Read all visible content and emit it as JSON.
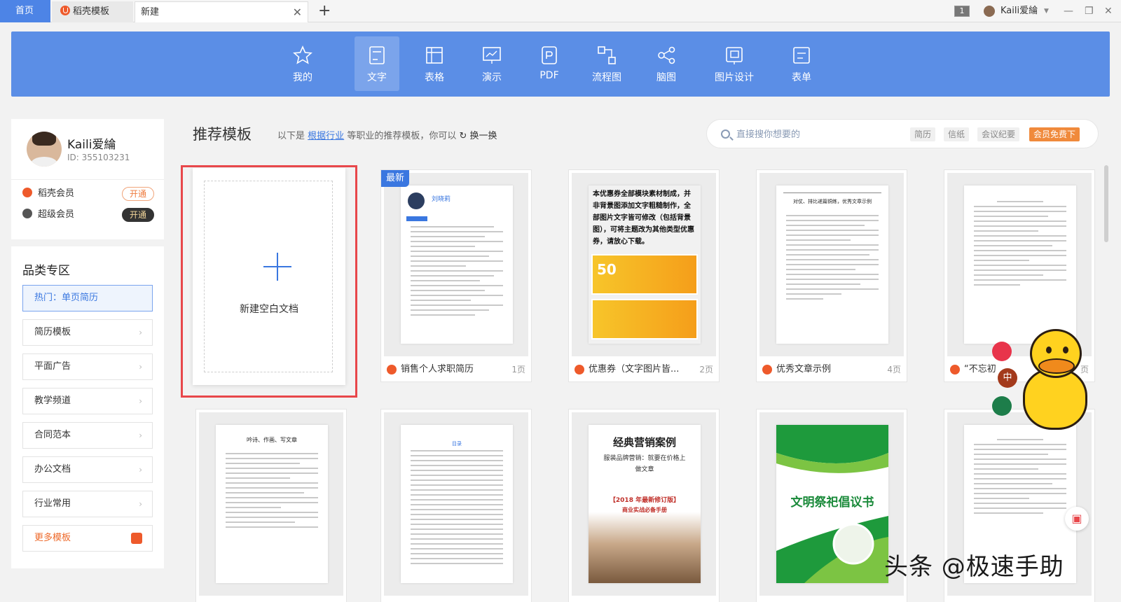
{
  "tabs": {
    "home": "首页",
    "templates": "稻壳模板",
    "current": "新建",
    "close": "✕",
    "add": "+"
  },
  "window": {
    "count": "1",
    "user": "Kaili爱綸",
    "minimize": "—",
    "restore": "❐",
    "close": "✕"
  },
  "nav": [
    {
      "label": "我的",
      "icon": "star-icon"
    },
    {
      "label": "文字",
      "icon": "document-icon"
    },
    {
      "label": "表格",
      "icon": "table-icon"
    },
    {
      "label": "演示",
      "icon": "presentation-icon"
    },
    {
      "label": "PDF",
      "icon": "pdf-icon"
    },
    {
      "label": "流程图",
      "icon": "flowchart-icon"
    },
    {
      "label": "脑图",
      "icon": "mindmap-icon"
    },
    {
      "label": "图片设计",
      "icon": "image-design-icon"
    },
    {
      "label": "表单",
      "icon": "form-icon"
    }
  ],
  "profile": {
    "name": "Kaili爱綸",
    "id": "ID: 355103231",
    "vip1_label": "稻壳会员",
    "vip1_btn": "开通",
    "vip2_label": "超级会员",
    "vip2_btn": "开通"
  },
  "category": {
    "title": "品类专区",
    "items": [
      "热门：单页简历",
      "简历模板",
      "平面广告",
      "教学频道",
      "合同范本",
      "办公文档",
      "行业常用",
      "更多模板"
    ]
  },
  "section": {
    "title": "推荐模板",
    "hint_prefix": "以下是",
    "hint_link": "根据行业",
    "hint_suffix": "等职业的推荐模板，你可以",
    "refresh_icon": "↻",
    "refresh": "换一换"
  },
  "search": {
    "placeholder": "直接搜你想要的",
    "chips": [
      "简历",
      "信纸",
      "会议纪要"
    ],
    "free": "会员免费下"
  },
  "blank": {
    "label": "新建空白文档"
  },
  "cards": [
    {
      "name": "销售个人求职简历",
      "pages": "1页",
      "badge": "最新"
    },
    {
      "name": "优惠券（文字图片皆...",
      "pages": "2页"
    },
    {
      "name": "优秀文章示例",
      "pages": "4页"
    },
    {
      "name": "“不忘初",
      "pages": "页"
    }
  ],
  "thumb_text": {
    "resume_name": "刘晓莉",
    "coupon_body": "本优惠券全部模块素材制成，并非背景图添加文字粗糙制作，全部图片文字皆可修改（包括背景图），可将主题改为其他类型优惠券，请放心下载。",
    "coupon_big": "50",
    "essay_title": "对仗、排比递篇铜练，优秀文章示例",
    "row2_title1": "吟诗、作画、写文章",
    "toc_title": "目录",
    "case_title": "经典营销案例",
    "case_sub": "服装品牌营销：就要在价格上做文章",
    "case_year": "【2018 年最新修订版】",
    "case_sub2": "商业实战必备手册",
    "green_title": "文明祭祀倡议书"
  },
  "float": {
    "zh": "中"
  },
  "watermark": "头条 @极速手助"
}
